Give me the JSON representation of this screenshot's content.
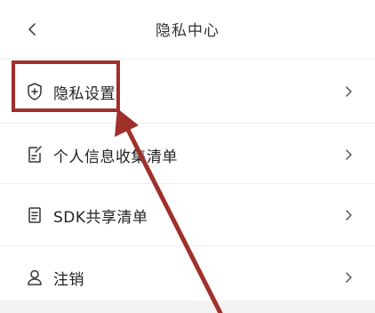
{
  "header": {
    "title": "隐私中心",
    "back_icon": "chevron-left-icon"
  },
  "menu": {
    "items": [
      {
        "label": "隐私设置",
        "icon": "shield-plus-icon"
      },
      {
        "label": "个人信息收集清单",
        "icon": "document-edit-icon"
      },
      {
        "label": "SDK共享清单",
        "icon": "list-document-icon"
      },
      {
        "label": "注销",
        "icon": "user-icon"
      }
    ],
    "chevron_icon": "chevron-right-icon"
  },
  "annotation": {
    "color": "#a0302b"
  }
}
